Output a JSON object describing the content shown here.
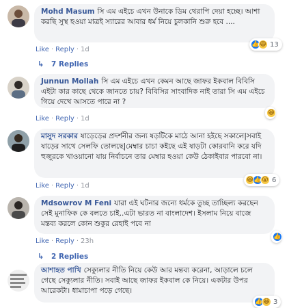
{
  "comments": [
    {
      "author": "Mohd Masum",
      "text": "সি এম এইচে এখন উনাকে ডিম থেরাপি দেয়া হচ্ছে। আশা করছি সুস্থ হওয়া মাত্রই স্যারের আবার ধর্ম নিয়ে চুলকানি শুরু হবে ....",
      "like_label": "Like",
      "reply_label": "Reply",
      "time": "1d",
      "reaction_count": "13",
      "replies_label": "7 Replies"
    },
    {
      "author": "Junnun Mollah",
      "text": "সি এম এইচে এখন কেমন আছে জাফর ইকবাল বিবিসি এইটা কার কাছে থেকে জানতে চায়? বিবিসির সাংবাদিক নাই তারা সি এম এইচে গিয়ে দেখে আসতে পারে না ?",
      "like_label": "Like",
      "reply_label": "Reply",
      "time": "1d",
      "reaction_count": "",
      "replies_label": ""
    },
    {
      "author": "মাসুদ সরকার",
      "text": "ষাড়েড়ের প্রদর্শনীর জন্য ষড়টিকে মাঠে আনা হইছে সকালে|সবাই ষাড়ের সাথে সেলফি তোলছে|মেম্বার চাচা কইছে এই ষাড়টা কোরবানি করে যদি হুজুরকে খাওয়ানো যায় নির্বাচনে তার মেম্বার হওয়া কেউ ঠেকাইবার পারবো না।",
      "like_label": "Like",
      "reply_label": "Reply",
      "time": "1d",
      "reaction_count": "6",
      "replies_label": ""
    },
    {
      "author": "Mdsowrov M Feni",
      "text": "যারা এই ঘটনার জন্যে ধর্মকে তুচ্ছ তাচ্ছিল্য করছেন সেই মুনাফিক কে বলতে চাই..এটা ভারত না বাংলাদেশ। ইসলাম নিয়ে বাজে মন্তব্য করলে কোন শুকুর রেহাই পবে না",
      "like_label": "Like",
      "reply_label": "Reply",
      "time": "23h",
      "reaction_count": "",
      "replies_label": "2 Replies"
    },
    {
      "author": "আশাহত পাখি",
      "text": "সেক্যুলার নীতি নিয়ে কেউ আর মন্তব্য করেনা, আড়ালে চলে গেছে সেক্যুলার নীতি। সবাই আছে জাফর ইকবাল কে নিয়ে। একটার উপর আরেকটা। ধামাচাপা পড়ে গেছে।",
      "like_label": "Like",
      "reply_label": "Reply",
      "time": "5 hrs",
      "reaction_count": "3",
      "replies_label": ""
    }
  ],
  "colors": {
    "link": "#385898",
    "bubble": "#f2f3f5",
    "meta": "#90949c",
    "action": "#4267b2"
  }
}
